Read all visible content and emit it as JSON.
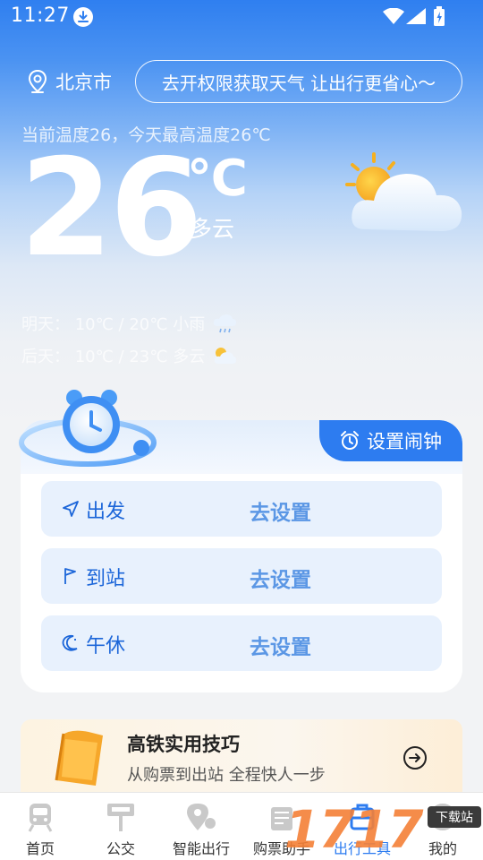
{
  "status_bar": {
    "time": "11:27"
  },
  "location": {
    "city": "北京市",
    "permission_button": "去开权限获取天气 让出行更省心～"
  },
  "weather": {
    "summary": "当前温度26，今天最高温度26℃",
    "temperature": "26",
    "unit": "℃",
    "condition": "多云",
    "forecast": [
      {
        "text": "明天： 10℃ / 20℃  小雨",
        "icon": "rain-cloud-icon"
      },
      {
        "text": "后天： 10℃ / 23℃  多云",
        "icon": "partly-cloudy-icon"
      }
    ]
  },
  "alarm_card": {
    "tab_label": "设置闹钟",
    "rows": [
      {
        "label": "出发",
        "action": "去设置",
        "icon": "navigate-icon"
      },
      {
        "label": "到站",
        "action": "去设置",
        "icon": "flag-icon"
      },
      {
        "label": "午休",
        "action": "去设置",
        "icon": "moon-icon"
      }
    ]
  },
  "tips": {
    "title": "高铁实用技巧",
    "subtitle": "从购票到出站 全程快人一步"
  },
  "bottom_nav": {
    "items": [
      {
        "label": "首页",
        "icon": "train-icon"
      },
      {
        "label": "公交",
        "icon": "bus-stop-icon"
      },
      {
        "label": "智能出行",
        "icon": "smart-travel-icon"
      },
      {
        "label": "购票助手",
        "icon": "ticket-icon"
      },
      {
        "label": "出行工具",
        "icon": "toolbox-icon"
      },
      {
        "label": "我的",
        "icon": "profile-icon"
      }
    ],
    "active_index": 4
  },
  "watermark": {
    "text": "1717",
    "badge": "下载站"
  },
  "colors": {
    "accent": "#2d7cf0",
    "sky_top": "#2f7ff0",
    "row_bg": "#e8f1fd"
  }
}
